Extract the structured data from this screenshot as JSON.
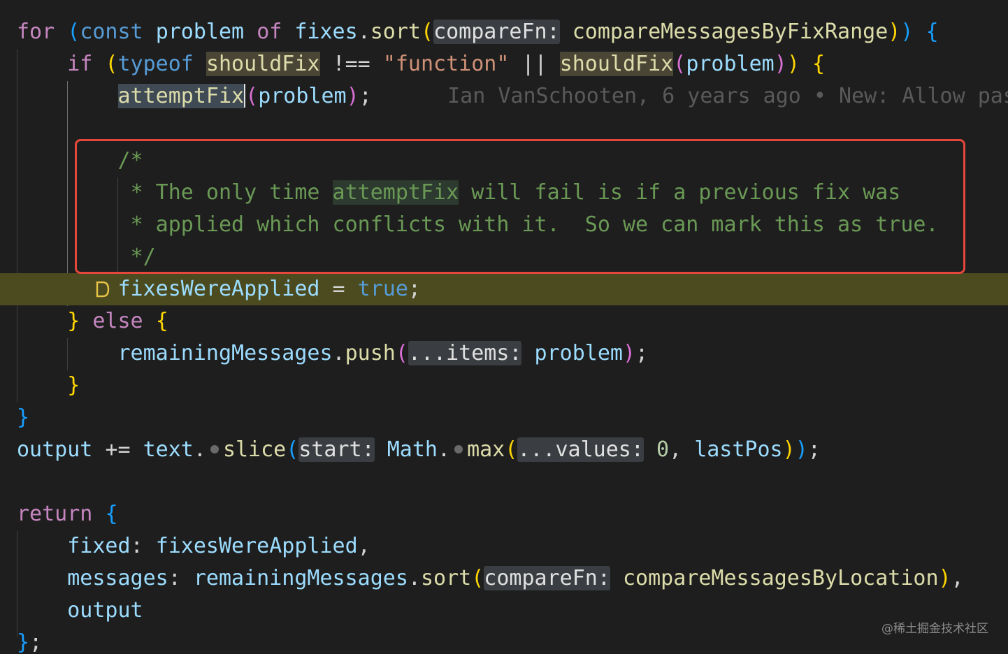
{
  "code": {
    "l1": {
      "for": "for",
      "open_paren": "(",
      "const": "const",
      "problem": "problem",
      "of": "of",
      "fixes": "fixes",
      "dot": ".",
      "sort": "sort",
      "call_paren": "(",
      "hint": "compareFn:",
      "arg": "compareMessagesByFixRange",
      "close_inner": ")",
      "close_outer": ")",
      "brace": "{"
    },
    "l2": {
      "if": "if",
      "open_paren": "(",
      "typeof": "typeof",
      "shouldFix": "shouldFix",
      "neq": "!==",
      "str": "\"function\"",
      "or": "||",
      "shouldFix2": "shouldFix",
      "call_open": "(",
      "problem": "problem",
      "call_close": ")",
      "close_paren": ")",
      "brace": "{"
    },
    "l3": {
      "attemptFix": "attemptFix",
      "open": "(",
      "problem": "problem",
      "close": ")",
      "semi": ";",
      "blame": "Ian VanSchooten, 6 years ago • New: Allow pas"
    },
    "comment": {
      "l5": "/*",
      "l6_pre": "* The only time ",
      "l6_hl": "attemptFix",
      "l6_post": " will fail is if a previous fix was",
      "l7": "* applied which conflicts with it.  So we can mark this as true.",
      "l8": "*/"
    },
    "l9": {
      "var": "fixesWereApplied",
      "eq": "=",
      "val": "true",
      "semi": ";"
    },
    "l10": {
      "close": "}",
      "else": "else",
      "brace": "{"
    },
    "l11": {
      "var": "remainingMessages",
      "dot": ".",
      "push": "push",
      "open": "(",
      "hint": "...items:",
      "arg": "problem",
      "close": ")",
      "semi": ";"
    },
    "l12": {
      "close": "}"
    },
    "l13": {
      "close": "}"
    },
    "l14": {
      "output": "output",
      "op": "+=",
      "text": "text",
      "dot": ".",
      "slice": "slice",
      "open": "(",
      "hint1": "start:",
      "math": "Math",
      "dot2": ".",
      "max": "max",
      "open2": "(",
      "hint2": "...values:",
      "zero": "0",
      "comma": ",",
      "lastPos": "lastPos",
      "close2": ")",
      "close": ")",
      "semi": ";"
    },
    "l16": {
      "return": "return",
      "brace": "{"
    },
    "l17": {
      "key": "fixed",
      "colon": ":",
      "val": "fixesWereApplied",
      "comma": ","
    },
    "l18": {
      "key": "messages",
      "colon": ":",
      "var": "remainingMessages",
      "dot": ".",
      "sort": "sort",
      "open": "(",
      "hint": "compareFn:",
      "arg": "compareMessagesByLocation",
      "close": ")",
      "comma": ","
    },
    "l19": {
      "output": "output"
    },
    "l20": {
      "close": "}",
      "semi": ";"
    }
  },
  "watermark": "@稀土掘金技术社区",
  "colors": {
    "background": "#1e1e1e",
    "current_line": "#4b4b1f",
    "annotation_box": "#e5473a"
  }
}
